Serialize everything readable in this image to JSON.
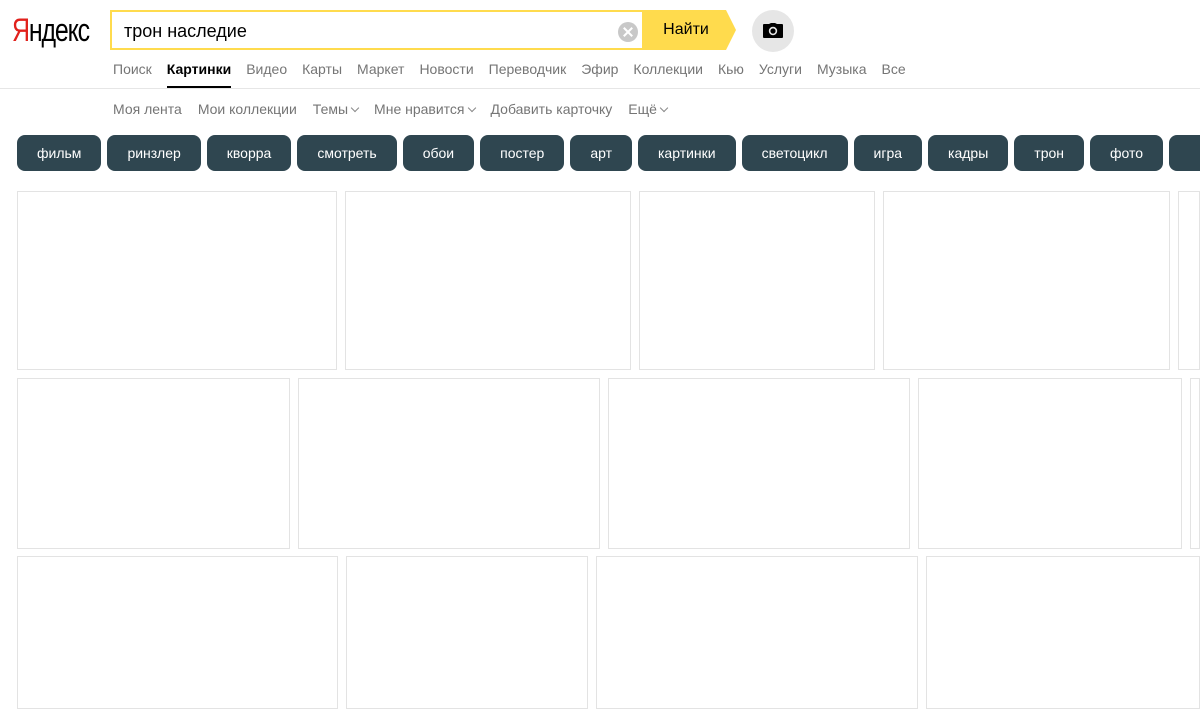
{
  "logo": {
    "first": "Я",
    "rest": "ндекс"
  },
  "search": {
    "query": "трон наследие",
    "button_label": "Найти"
  },
  "services": [
    {
      "label": "Поиск",
      "active": false
    },
    {
      "label": "Картинки",
      "active": true
    },
    {
      "label": "Видео",
      "active": false
    },
    {
      "label": "Карты",
      "active": false
    },
    {
      "label": "Маркет",
      "active": false
    },
    {
      "label": "Новости",
      "active": false
    },
    {
      "label": "Переводчик",
      "active": false
    },
    {
      "label": "Эфир",
      "active": false
    },
    {
      "label": "Коллекции",
      "active": false
    },
    {
      "label": "Кью",
      "active": false
    },
    {
      "label": "Услуги",
      "active": false
    },
    {
      "label": "Музыка",
      "active": false
    },
    {
      "label": "Все",
      "active": false
    }
  ],
  "subnav": [
    {
      "label": "Моя лента",
      "dropdown": false
    },
    {
      "label": "Мои коллекции",
      "dropdown": false
    },
    {
      "label": "Темы",
      "dropdown": true
    },
    {
      "label": "Мне нравится",
      "dropdown": true
    },
    {
      "label": "Добавить карточку",
      "dropdown": false
    },
    {
      "label": "Ещё",
      "dropdown": true
    }
  ],
  "chips": [
    "фильм",
    "ринзлер",
    "кворра",
    "смотреть",
    "обои",
    "постер",
    "арт",
    "картинки",
    "светоцикл",
    "игра",
    "кадры",
    "трон",
    "фото",
    ""
  ],
  "colors": {
    "accent": "#ffdb4d",
    "chip_bg": "#2f4650",
    "logo_red": "#e1211c"
  },
  "icons": {
    "clear": "clear-icon",
    "camera": "camera-icon",
    "dropdown": "chevron-down-icon"
  }
}
